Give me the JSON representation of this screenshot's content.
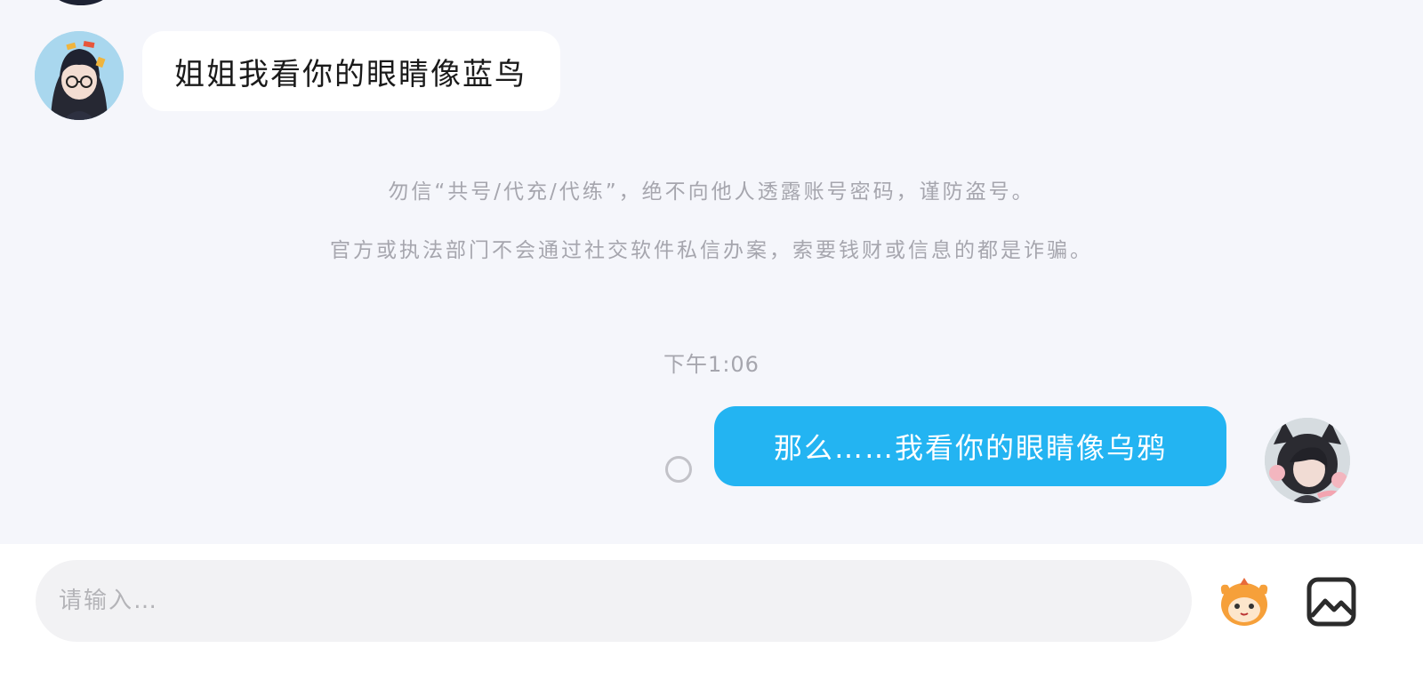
{
  "messages": [
    {
      "direction": "incoming",
      "text": "姐姐我看你的眼睛像蓝鸟"
    },
    {
      "direction": "outgoing",
      "text": "那么……我看你的眼睛像乌鸦"
    }
  ],
  "notices": [
    "勿信“共号/代充/代练”，绝不向他人透露账号密码，谨防盗号。",
    "官方或执法部门不会通过社交软件私信办案，索要钱财或信息的都是诈骗。"
  ],
  "timestamp": "下午1:06",
  "composer": {
    "placeholder": "请输入…",
    "emoji_icon": "emoji-face-icon",
    "image_icon": "image-icon"
  },
  "colors": {
    "chat_background": "#f5f6fb",
    "outgoing_bubble": "#23b4f2",
    "incoming_bubble": "#ffffff",
    "notice_text": "#a6a6ae"
  }
}
